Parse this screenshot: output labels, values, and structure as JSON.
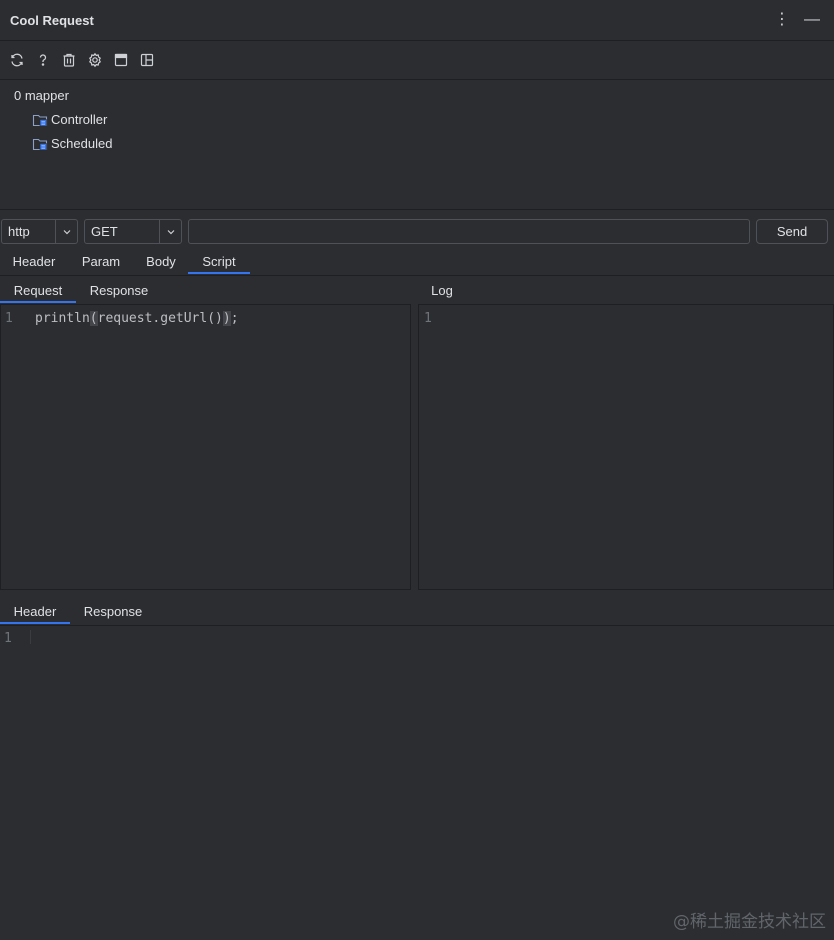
{
  "window": {
    "title": "Cool Request",
    "more_icon": "⋮",
    "minimize_icon": "—"
  },
  "toolbar": {
    "icons": [
      "refresh-icon",
      "help-icon",
      "trash-icon",
      "gear-icon",
      "window-icon",
      "layout-icon"
    ]
  },
  "tree": {
    "root_label": "0 mapper",
    "items": [
      {
        "label": "Controller",
        "icon": "folder-class-icon"
      },
      {
        "label": "Scheduled",
        "icon": "folder-class-icon"
      }
    ]
  },
  "request": {
    "protocol": "http",
    "method": "GET",
    "url_value": "",
    "send_label": "Send"
  },
  "request_tabs": [
    "Header",
    "Param",
    "Body",
    "Script"
  ],
  "script_tabs": [
    "Request",
    "Response"
  ],
  "log_label": "Log",
  "script_editor": {
    "line_number": "1",
    "code_pre": "println",
    "code_open": "(",
    "code_mid": "request.getUrl()",
    "code_close": ")",
    "code_post": ";"
  },
  "log_editor": {
    "line_number": "1"
  },
  "response_tabs": [
    "Header",
    "Response"
  ],
  "response_editor": {
    "line_number": "1"
  },
  "watermark": "@稀土掘金技术社区",
  "colors": {
    "background": "#2b2d30",
    "accent": "#3574f0",
    "border": "#1e1f22"
  }
}
